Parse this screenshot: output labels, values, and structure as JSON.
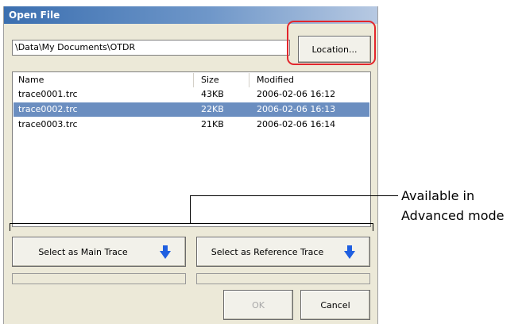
{
  "dialog": {
    "title": "Open File",
    "path": "\\Data\\My Documents\\OTDR",
    "location_button": "Location...",
    "columns": {
      "name": "Name",
      "size": "Size",
      "modified": "Modified"
    },
    "files": [
      {
        "name": "trace0001.trc",
        "size": "43KB",
        "modified": "2006-02-06 16:12"
      },
      {
        "name": "trace0002.trc",
        "size": "22KB",
        "modified": "2006-02-06 16:13",
        "selected": true
      },
      {
        "name": "trace0003.trc",
        "size": "21KB",
        "modified": "2006-02-06 16:14"
      }
    ],
    "select_main_button": "Select as Main Trace",
    "select_reference_button": "Select as Reference Trace",
    "ok_button": "OK",
    "cancel_button": "Cancel"
  },
  "callout": {
    "line1": "Available in",
    "line2": "Advanced mode"
  },
  "colors": {
    "selection": "#6b8ec0",
    "highlight_ring": "#e2262c",
    "arrow": "#1f5fe0"
  },
  "icons": [
    "down-arrow-icon",
    "down-arrow-icon"
  ]
}
